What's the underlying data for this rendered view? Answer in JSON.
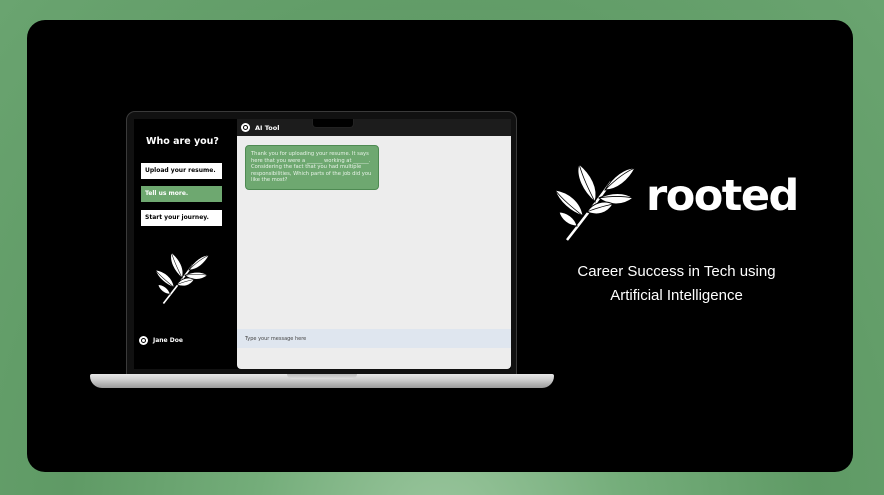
{
  "brand": {
    "name": "rooted",
    "tagline_line1": "Career Success in Tech using",
    "tagline_line2": "Artificial Intelligence"
  },
  "sidebar": {
    "title": "Who are you?",
    "items": [
      {
        "label": "Upload your resume."
      },
      {
        "label": "Tell us more.",
        "active": true
      },
      {
        "label": "Start your journey."
      }
    ],
    "user_name": "Jane Doe"
  },
  "chat": {
    "title": "AI Tool",
    "message": "Thank you for uploading your resume. It says here that you were a ______ working at ______. Considering the fact that you had multiple responsibilities, Which parts of the job did you like the most?",
    "input_placeholder": "Type your message here"
  },
  "colors": {
    "accent_green": "#6ea870",
    "background": "#000000"
  },
  "icons": [
    "leaf-branch-icon",
    "user-avatar-icon"
  ]
}
